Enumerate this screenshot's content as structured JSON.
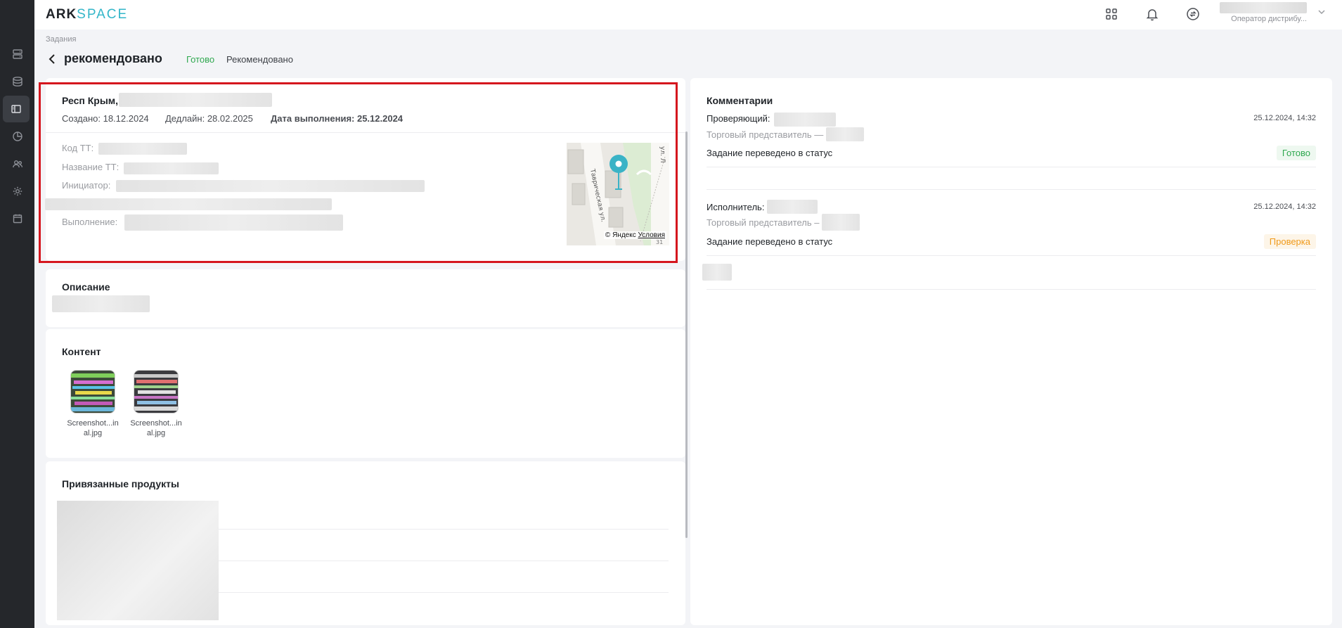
{
  "app": {
    "logo_primary": "ARK",
    "logo_secondary": "SPACE",
    "user_role": "Оператор дистрибу...",
    "colors": {
      "accent": "#33b6c9",
      "success": "#2fa84f",
      "warning": "#f09a1a",
      "highlight_border": "#d5161e",
      "rail": "#25272b"
    }
  },
  "rail": {
    "items": [
      {
        "icon": "server-list-icon"
      },
      {
        "icon": "database-icon"
      },
      {
        "icon": "sidebar-layout-icon",
        "active": true
      },
      {
        "icon": "pie-chart-icon"
      },
      {
        "icon": "users-icon"
      },
      {
        "icon": "gear-icon"
      },
      {
        "icon": "calendar-icon"
      }
    ]
  },
  "topbar": {
    "icons": [
      "apps-grid-icon",
      "bell-icon",
      "sync-icon"
    ]
  },
  "header": {
    "breadcrumb": "Задания",
    "title": "рекомендовано",
    "status": "Готово",
    "status_value": "Рекомендовано"
  },
  "task": {
    "address_prefix": "Респ Крым,",
    "created": "Создано: 18.12.2024",
    "deadline": "Дедлайн: 28.02.2025",
    "completion_label": "Дата выполнения: 25.12.2024",
    "fields": {
      "code_label": "Код ТТ:",
      "name_label": "Название ТТ:",
      "initiator_label": "Инициатор:",
      "execution_label": "Выполнение:"
    },
    "map": {
      "street_label": "Таврическая ул.",
      "street_label_2": "ул. Л",
      "house_number": "31",
      "attribution": "© Яндекс",
      "terms_link": "Условия"
    }
  },
  "description": {
    "title": "Описание"
  },
  "content": {
    "title": "Контент",
    "files": [
      {
        "name_line1": "Screenshot...in",
        "name_line2": "al.jpg"
      },
      {
        "name_line1": "Screenshot...in",
        "name_line2": "al.jpg"
      }
    ]
  },
  "products": {
    "title": "Привязанные продукты"
  },
  "comments": {
    "title": "Комментарии",
    "entries": [
      {
        "role_label": "Проверяющий:",
        "timestamp": "25.12.2024, 14:32",
        "position": "Торговый представитель —",
        "message": "Задание переведено в статус",
        "status": "Готово"
      },
      {
        "role_label": "Исполнитель:",
        "timestamp": "25.12.2024, 14:32",
        "position": "Торговый представитель –",
        "message": "Задание переведено в статус",
        "status": "Проверка"
      }
    ]
  }
}
